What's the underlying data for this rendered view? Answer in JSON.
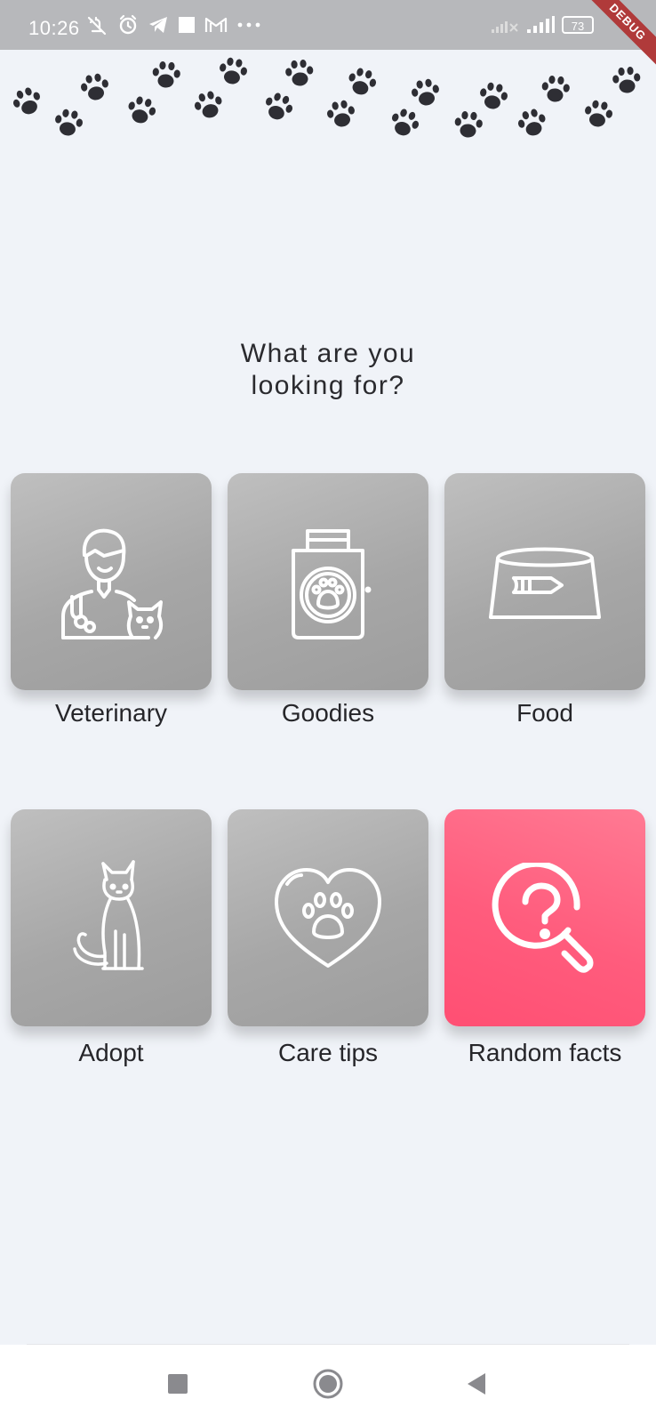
{
  "status_bar": {
    "time": "10:26",
    "battery": "73",
    "debug": "DEBUG",
    "icons": [
      "mute-icon",
      "alarm-icon",
      "telegram-icon",
      "square-icon",
      "gmail-icon",
      "more-icon",
      "signal-x-icon",
      "signal-icon",
      "battery-icon"
    ]
  },
  "question": {
    "line1": "What are you",
    "line2": "looking for?"
  },
  "tiles": [
    {
      "label": "Veterinary",
      "icon": "veterinarian-icon"
    },
    {
      "label": "Goodies",
      "icon": "shopping-bag-paw-icon"
    },
    {
      "label": "Food",
      "icon": "pet-bowl-icon"
    },
    {
      "label": "Adopt",
      "icon": "cat-icon"
    },
    {
      "label": "Care tips",
      "icon": "heart-paw-icon"
    },
    {
      "label": "Random facts",
      "icon": "search-question-icon"
    }
  ],
  "colors": {
    "tile_gray": "#a9a9a9",
    "tile_accent": "#ff5c7d",
    "background": "#f0f3f8",
    "paw": "#2e2e34"
  },
  "nav": {
    "icons": [
      "recent-apps-icon",
      "home-icon",
      "back-icon"
    ]
  }
}
